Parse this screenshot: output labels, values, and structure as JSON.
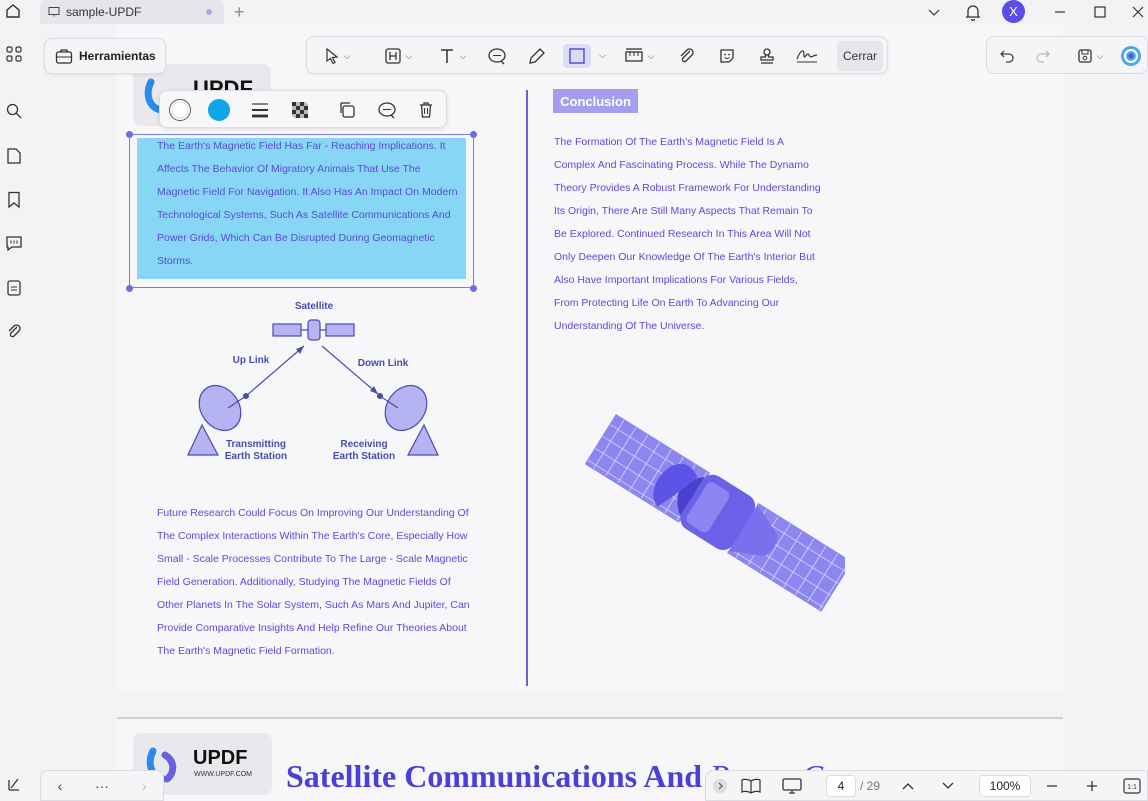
{
  "titlebar": {
    "tab_title": "sample-UPDF",
    "avatar_initial": "X"
  },
  "toolbar": {
    "tools_label": "Herramientas",
    "close_label": "Cerrar"
  },
  "page": {
    "logo_text": "UPDF",
    "logo_url": "WWW.UPDF.COM",
    "highlight_lines": [
      "The Earth's Magnetic Field Has Far - Reaching Implications. It",
      "Affects The Behavior Of Migratory Animals That Use The",
      "Magnetic Field For Navigation. It Also Has An Impact On Modern",
      "Technological Systems, Such As Satellite Communications And",
      "Power Grids, Which Can Be Disrupted During Geomagnetic",
      "Storms."
    ],
    "diagram": {
      "satellite": "Satellite",
      "uplink": "Up Link",
      "downlink": "Down Link",
      "transmitting": "Transmitting\nEarth Station",
      "receiving": "Receiving\nEarth Station"
    },
    "future_lines": [
      "Future Research Could Focus On Improving Our Understanding Of",
      "The Complex Interactions Within The Earth's Core, Especially How",
      "Small - Scale Processes Contribute To The Large - Scale Magnetic",
      "Field Generation. Additionally, Studying The Magnetic Fields Of",
      "Other Planets In The Solar System, Such As Mars And Jupiter, Can",
      "Provide Comparative Insights And Help Refine Our Theories About",
      "The Earth's Magnetic Field Formation."
    ],
    "conclusion_title": "Conclusion",
    "conclusion_lines": [
      "The Formation Of The Earth's Magnetic Field Is A",
      "Complex And Fascinating Process. While The Dynamo",
      "Theory Provides A Robust Framework For Understanding",
      "Its Origin, There Are Still Many Aspects That Remain To",
      "Be Explored. Continued Research In This Area Will Not",
      "Only Deepen Our Knowledge Of The Earth's Interior But",
      "Also Have Important Implications For Various Fields,",
      "From Protecting Life On Earth To Advancing Our",
      "Understanding Of The Universe."
    ],
    "next_title_main": "Satellite Communications And",
    "next_title_italic": "Power Gr"
  },
  "bottom": {
    "more_label": "···",
    "current_page": "4",
    "total_pages": "/ 29",
    "zoom": "100%"
  },
  "colors": {
    "accent": "#5a4bd8",
    "highlight": "#87d6f6",
    "annot_fill": "#0ea5e9"
  }
}
